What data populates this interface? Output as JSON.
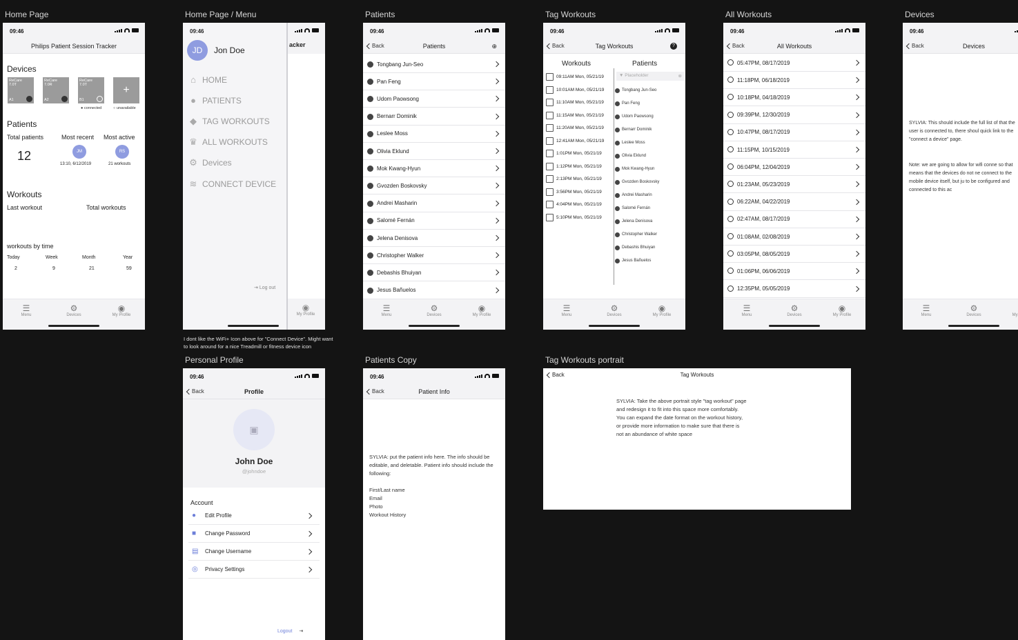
{
  "status": {
    "time": "09:46"
  },
  "tabbar": {
    "menu": "Menu",
    "devices": "Devices",
    "profile": "My Profile"
  },
  "icons": {
    "back": "chevron-left-icon",
    "forward": "chevron-right-icon",
    "person": "person-icon",
    "history": "history-icon",
    "gear": "gear-icon",
    "filter": "filter-icon",
    "help": "help-icon",
    "add_user": "add-user-icon",
    "logout": "logout-icon"
  },
  "colors": {
    "accent": "#8f9ce0",
    "frame_bg": "#141414",
    "bar_bg": "#f3f3f5"
  },
  "frames": {
    "home": "Home Page",
    "menu": "Home Page / Menu",
    "patients": "Patients",
    "tag": "Tag Workouts",
    "all": "All Workouts",
    "devices": "Devices",
    "profile": "Personal Profile",
    "patcopy": "Patients Copy",
    "tagportrait": "Tag Workouts portrait"
  },
  "home": {
    "title": "Philips Patient Session Tracker",
    "devices_h": "Devices",
    "devices": [
      {
        "name": "ReCare",
        "model": "7.0T",
        "slot": "A1"
      },
      {
        "name": "ReCare",
        "model": "7.0R",
        "slot": "A2"
      },
      {
        "name": "ReCare",
        "model": "7.0T",
        "slot": "B1"
      }
    ],
    "add": "+",
    "connected": "connected",
    "unavailable": "unavailable",
    "patients_h": "Patients",
    "total_lbl": "Total patients",
    "total": "12",
    "recent_lbl": "Most recent",
    "active_lbl": "Most active",
    "recent_initials": "JM",
    "recent_sub": "13:10, 6/12/2019",
    "active_initials": "RS",
    "active_sub": "21 workouts",
    "workouts_h": "Workouts",
    "last": "Last workout",
    "totalw": "Total workouts",
    "bytime": "workouts by time",
    "periods": [
      {
        "l": "Today",
        "v": "2"
      },
      {
        "l": "Week",
        "v": "9"
      },
      {
        "l": "Month",
        "v": "21"
      },
      {
        "l": "Year",
        "v": "59"
      }
    ]
  },
  "menu": {
    "initials": "JD",
    "name": "Jon Doe",
    "items": [
      "HOME",
      "PATIENTS",
      "TAG WORKOUTS",
      "ALL WORKOUTS",
      "Devices",
      "CONNECT DEVICE"
    ],
    "logout": "Log out",
    "behind": "acker",
    "comment": "I dont like the WiFi+ Icon above for \"Connect Device\". Might want to look around for a nice Treadmill or fitness device icon"
  },
  "patients": {
    "back": "Back",
    "title": "Patients",
    "list": [
      "Tongbang Jun-Seo",
      "Pan Feng",
      "Udom Paowsong",
      "Bernarr Dominik",
      "Leslee Moss",
      "Olivia Eklund",
      "Mok Kwang-Hyun",
      "Gvozden Boskovsky",
      "Andrei Masharin",
      "Salomé Fernán",
      "Jelena Denisova",
      "Christopher Walker",
      "Debashis Bhuiyan",
      "Jesus Bañuelos"
    ]
  },
  "tag": {
    "back": "Back",
    "title": "Tag Workouts",
    "wh": "Workouts",
    "ph": "Patients",
    "placeholder": "Placeholder",
    "workouts": [
      "09:11AM Mon, 05/21/19",
      "10:01AM Mon, 05/21/19",
      "11:10AM Mon, 05/21/19",
      "11:15AM Mon, 05/21/19",
      "11:20AM Mon, 05/21/19",
      "12:41AM Mon, 05/21/19",
      "1:01PM Mon, 05/21/19",
      "1:12PM Mon, 05/21/19",
      "2:13PM Mon, 05/21/19",
      "3:56PM Mon, 05/21/19",
      "4:04PM Mon, 05/21/19",
      "5:10PM Mon, 05/21/19"
    ],
    "patients": [
      "Tongbang Jun-Seo",
      "Pan Feng",
      "Udom Paowsong",
      "Bernarr Dominik",
      "Leslee Moss",
      "Olivia Eklund",
      "Mok Kwang-Hyun",
      "Gvozden Boskovsky",
      "Andrei Masharin",
      "Salomé Fernán",
      "Jelena Denisova",
      "Christopher Walker",
      "Debashis Bhuiyan",
      "Jesus Bañuelos"
    ]
  },
  "all": {
    "back": "Back",
    "title": "All Workouts",
    "list": [
      "05:47PM, 08/17/2019",
      "11:18PM, 06/18/2019",
      "10:18PM, 04/18/2019",
      "09:39PM, 12/30/2019",
      "10:47PM, 08/17/2019",
      "11:15PM, 10/15/2019",
      "06:04PM, 12/04/2019",
      "01:23AM, 05/23/2019",
      "06:22AM, 04/22/2019",
      "02:47AM, 08/17/2019",
      "01:08AM, 02/08/2019",
      "03:05PM, 08/05/2019",
      "01:06PM, 06/06/2019",
      "12:35PM, 05/05/2019"
    ]
  },
  "devices": {
    "back": "Back",
    "title": "Devices",
    "note1": "SYLVIA: This should include the full list of that the user is connected to, there shoul quick link to the \"connect a device\" page.",
    "note2": "Note: we are going to allow for wifi conne so that means that the devices do not ne connect to the mobile device itself, but ju to be configured and connected to this ac"
  },
  "profile": {
    "back": "Back",
    "title": "Profile",
    "name": "John Doe",
    "handle": "@johndoe",
    "account": "Account",
    "items": [
      "Edit Profile",
      "Change Password",
      "Change Username",
      "Privacy Settings"
    ],
    "logout": "Logout"
  },
  "patcopy": {
    "back": "Back",
    "title": "Patient Info",
    "note": "SYLVIA: put the patient info here. The info should be editable, and deletable. Patient info should include the following:",
    "fields": [
      "First/Last name",
      "Email",
      "Photo",
      "Workout History"
    ]
  },
  "tagportrait": {
    "back": "Back",
    "title": "Tag Workouts",
    "note": "SYLVIA: Take the above portrait style \"tag workout\" page and redesign it to fit into this space more comfortably. You can expand the date format on the workout history, or provide more information to make sure that there is not an abundance of white space"
  }
}
